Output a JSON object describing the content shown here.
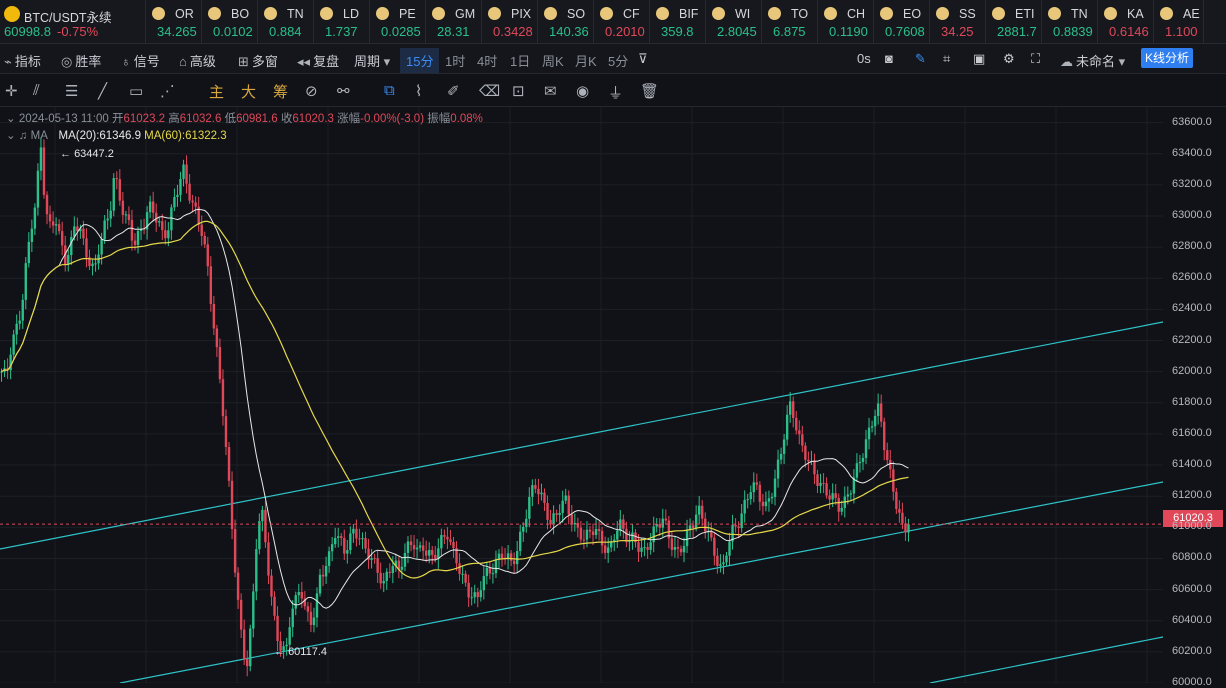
{
  "tickers": [
    {
      "sym": "BTC/USDT永续",
      "pr": "60998.8",
      "chg": "-0.75%",
      "color": "green",
      "w": 146
    },
    {
      "sym": "OR",
      "pr": "34.265",
      "color": "green",
      "w": 56
    },
    {
      "sym": "BO",
      "pr": "0.0102",
      "color": "green",
      "w": 56
    },
    {
      "sym": "TN",
      "pr": "0.884",
      "color": "green",
      "w": 56
    },
    {
      "sym": "LD",
      "pr": "1.737",
      "color": "green",
      "w": 56
    },
    {
      "sym": "PE",
      "pr": "0.0285",
      "color": "green",
      "w": 56
    },
    {
      "sym": "GM",
      "pr": "28.31",
      "color": "green",
      "w": 56
    },
    {
      "sym": "PIX",
      "pr": "0.3428",
      "color": "red",
      "w": 56
    },
    {
      "sym": "SO",
      "pr": "140.36",
      "color": "green",
      "w": 56
    },
    {
      "sym": "CF",
      "pr": "0.2010",
      "color": "red",
      "w": 56
    },
    {
      "sym": "BIF",
      "pr": "359.8",
      "color": "green",
      "w": 56
    },
    {
      "sym": "WI",
      "pr": "2.8045",
      "color": "green",
      "w": 56
    },
    {
      "sym": "TO",
      "pr": "6.875",
      "color": "green",
      "w": 56
    },
    {
      "sym": "CH",
      "pr": "0.1190",
      "color": "green",
      "w": 56
    },
    {
      "sym": "EO",
      "pr": "0.7608",
      "color": "green",
      "w": 56
    },
    {
      "sym": "SS",
      "pr": "34.25",
      "color": "red",
      "w": 56
    },
    {
      "sym": "ETI",
      "pr": "2881.7",
      "color": "green",
      "w": 56
    },
    {
      "sym": "TN",
      "pr": "0.8839",
      "color": "green",
      "w": 56
    },
    {
      "sym": "KA",
      "pr": "0.6146",
      "color": "red",
      "w": 56
    },
    {
      "sym": "AE",
      "pr": "1.100",
      "color": "red",
      "w": 50
    }
  ],
  "toolbar": {
    "indicators": "指标",
    "win_rate": "胜率",
    "signal": "信号",
    "advanced": "高级",
    "multi_window": "多窗",
    "replay": "复盘",
    "period": "周期",
    "p15": "15分",
    "p1h": "1时",
    "p4h": "4时",
    "p1d": "1日",
    "p1w": "周K",
    "p1m": "月K",
    "p5m": "5分",
    "countdown": "0s",
    "layout_name": "未命名",
    "kline_analysis": "K线分析"
  },
  "drawbar": {
    "main": "主",
    "big": "大",
    "chip": "筹"
  },
  "legend": {
    "date": "2024-05-13 11:00",
    "open_label": "开",
    "open": "61023.2",
    "high_label": "高",
    "high": "61032.6",
    "low_label": "低",
    "low": "60981.6",
    "close_label": "收",
    "close": "61020.3",
    "chg_label": "涨幅",
    "chg": "-0.00%(-3.0)",
    "amp_label": "振幅",
    "amp": "0.08%",
    "ma_label": "MA",
    "ma20": "MA(20):61346.9",
    "ma60": "MA(60):61322.3"
  },
  "chart_data": {
    "type": "candlestick",
    "instrument": "BTC/USDT永续",
    "interval": "15分",
    "ylim": [
      60000,
      63700
    ],
    "yticks": [
      63600,
      63400,
      63200,
      63000,
      62800,
      62600,
      62400,
      62200,
      62000,
      61800,
      61600,
      61400,
      61200,
      61000,
      60800,
      60600,
      60400,
      60200,
      60000
    ],
    "ytick_labels": [
      "63600.0",
      "63400.0",
      "63200.0",
      "63000.0",
      "62800.0",
      "62600.0",
      "62400.0",
      "62200.0",
      "62000.0",
      "61800.0",
      "61600.0",
      "61400.0",
      "61200.0",
      "61000.0",
      "60800.0",
      "60600.0",
      "60400.0",
      "60200.0",
      "60000.0"
    ],
    "last_price": "61020.3",
    "high_mark": "63447.2",
    "low_mark": "60117.4",
    "price_path": [
      62000,
      61950,
      62150,
      62250,
      62400,
      62700,
      62950,
      63100,
      63450,
      63000,
      62900,
      63000,
      62850,
      62750,
      62800,
      62950,
      62900,
      62750,
      62700,
      62650,
      62850,
      62950,
      63000,
      63250,
      63100,
      63000,
      62950,
      62850,
      62900,
      62950,
      63050,
      63000,
      62950,
      62850,
      62950,
      63100,
      63200,
      63300,
      63150,
      63050,
      62980,
      62900,
      62700,
      62400,
      62100,
      61800,
      61400,
      61000,
      60600,
      60300,
      60117,
      60400,
      60900,
      61100,
      60850,
      60550,
      60350,
      60250,
      60200,
      60450,
      60500,
      60600,
      60450,
      60400,
      60500,
      60700,
      60750,
      60800,
      60950,
      60900,
      60850,
      60950,
      61000,
      60950,
      60850,
      60800,
      60750,
      60700,
      60650,
      60750,
      60800,
      60700,
      60800,
      60850,
      60900,
      60850,
      60900,
      60850,
      60800,
      60850,
      60900,
      60950,
      60850,
      60800,
      60700,
      60600,
      60550,
      60500,
      60650,
      60700,
      60750,
      60800,
      60850,
      60800,
      60750,
      60800,
      60950,
      61100,
      61250,
      61300,
      61200,
      61100,
      61000,
      61050,
      61150,
      61200,
      61100,
      61000,
      60950,
      60900,
      60950,
      61000,
      60950,
      60900,
      60850,
      60950,
      61000,
      60950,
      60900,
      60950,
      60900,
      60850,
      60900,
      60950,
      61000,
      61050,
      60950,
      60900,
      60850,
      60900,
      60950,
      61000,
      61100,
      61050,
      61000,
      60900,
      60800,
      60700,
      60850,
      60950,
      61000,
      61100,
      61200,
      61300,
      61250,
      61150,
      61100,
      61200,
      61350,
      61500,
      61700,
      61800,
      61650,
      61500,
      61450,
      61400,
      61350,
      61300,
      61250,
      61200,
      61150,
      61100,
      61150,
      61250,
      61350,
      61450,
      61500,
      61600,
      61700,
      61750,
      61550,
      61400,
      61250,
      61100,
      60950,
      61020
    ]
  }
}
